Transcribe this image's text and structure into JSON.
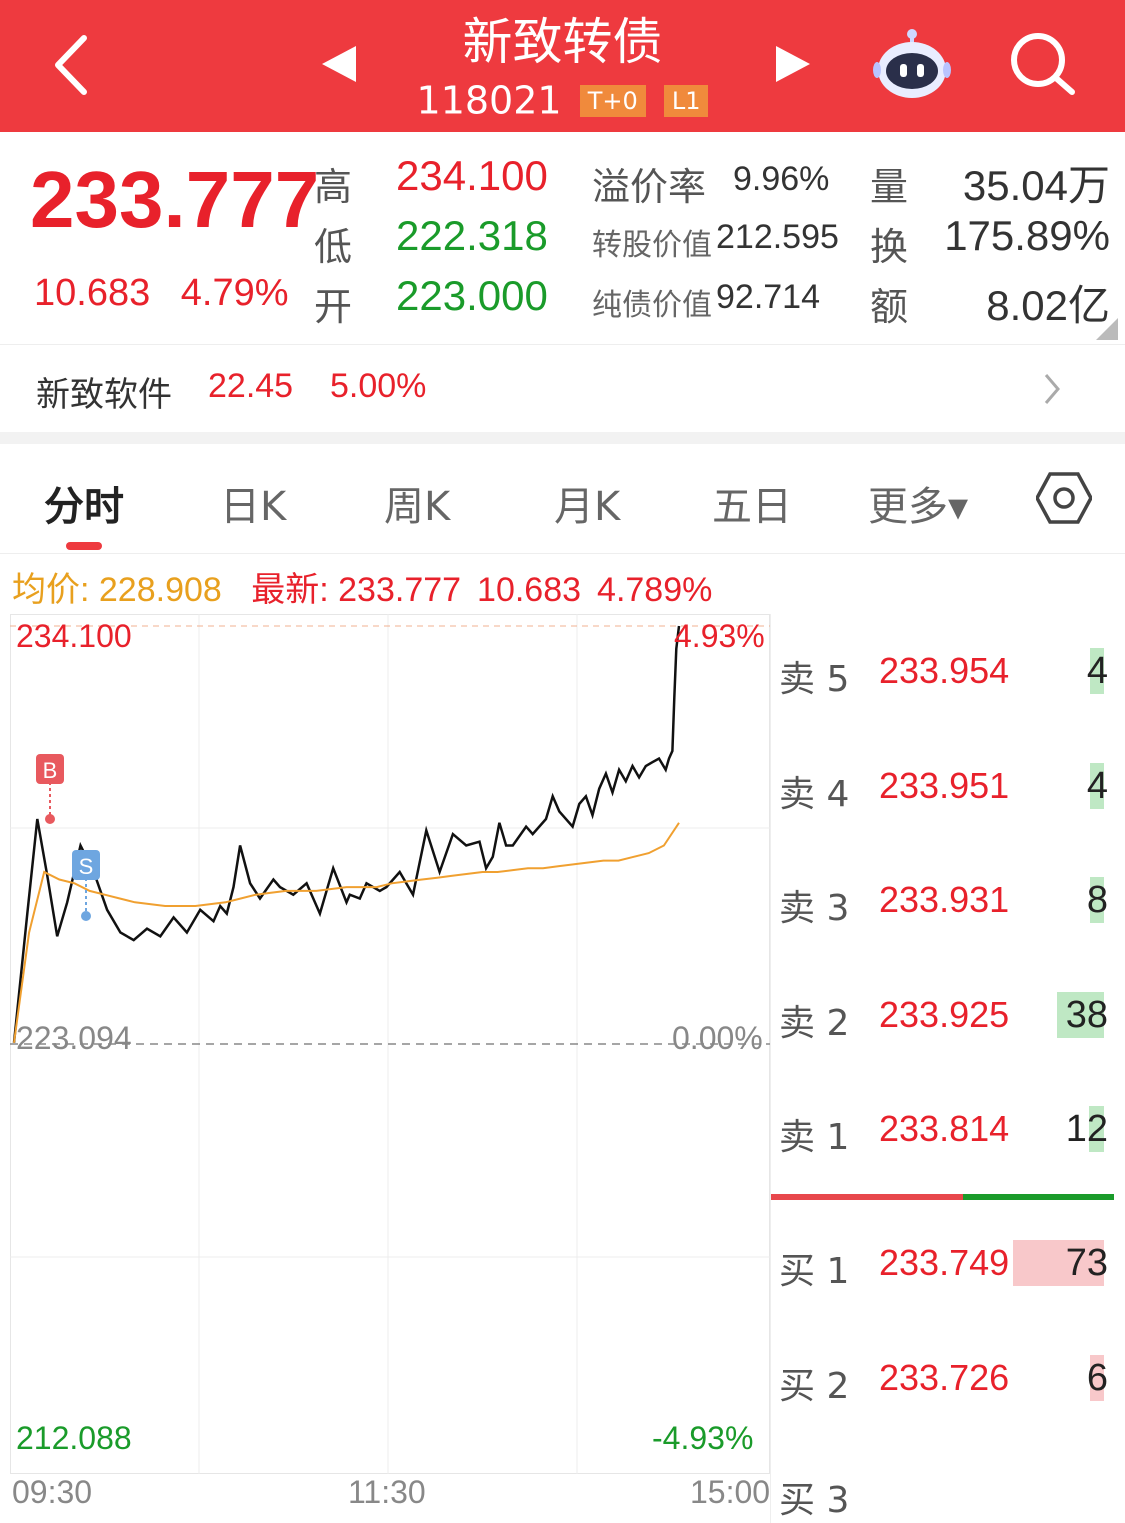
{
  "header": {
    "title": "新致转债",
    "code": "118021",
    "tags": [
      "T+0",
      "L1"
    ]
  },
  "quote": {
    "last_price": "233.777",
    "change": "10.683",
    "change_pct": "4.79%",
    "high_label": "高",
    "high": "234.100",
    "low_label": "低",
    "low": "222.318",
    "open_label": "开",
    "open": "223.000",
    "premium_label": "溢价率",
    "premium": "9.96%",
    "conv_value_label": "转股价值",
    "conv_value": "212.595",
    "bond_value_label": "纯债价值",
    "bond_value": "92.714",
    "volume_label": "量",
    "volume": "35.04万",
    "turnover_label": "换",
    "turnover": "175.89%",
    "amount_label": "额",
    "amount": "8.02亿"
  },
  "stock": {
    "name": "新致软件",
    "price": "22.45",
    "change_pct": "5.00%"
  },
  "tabs": [
    "分时",
    "日K",
    "周K",
    "月K",
    "五日",
    "更多▾"
  ],
  "chart_info": {
    "avg_label": "均价: 228.908",
    "latest_label": "最新: 233.777",
    "latest_change": "10.683",
    "latest_pct": "4.789%"
  },
  "chart_data": {
    "type": "line",
    "y_axis": {
      "max": "234.100",
      "mid": "223.094",
      "min": "212.088"
    },
    "pct_axis": {
      "max": "4.93%",
      "mid": "0.00%",
      "min": "-4.93%"
    },
    "x_ticks": [
      "09:30",
      "11:30",
      "15:00"
    ],
    "ylim": [
      212.088,
      234.1
    ],
    "markers": [
      {
        "label": "B",
        "color": "#e8595e"
      },
      {
        "label": "S",
        "color": "#6ea6e0"
      }
    ],
    "series": [
      {
        "color": "#111111",
        "values": [
          223.09,
          226.5,
          229.0,
          227.5,
          225.9,
          226.8,
          228.3,
          227.6,
          226.6,
          226.0,
          225.8,
          226.1,
          225.9,
          226.4,
          226.0,
          226.6,
          226.3,
          226.7,
          226.5,
          227.2,
          228.3,
          227.3,
          226.9,
          227.4,
          227.2,
          227.0,
          227.3,
          226.5,
          227.7,
          226.8,
          227.0,
          226.9,
          227.3,
          227.1,
          227.2,
          227.6,
          227.0,
          228.7,
          227.6,
          228.6,
          228.3,
          228.4,
          227.7,
          228.0,
          228.9,
          228.3,
          228.3,
          228.8,
          228.6,
          229.0,
          229.6,
          229.2,
          228.8,
          229.4,
          229.6,
          229.1,
          229.8,
          230.2,
          229.7,
          230.3,
          230.0,
          230.4,
          230.1,
          230.4,
          230.5,
          230.6,
          230.3,
          230.6,
          230.8,
          232.2,
          233.5,
          234.1
        ]
      },
      {
        "color": "#f0a030",
        "values": [
          223.09,
          226.0,
          227.6,
          227.4,
          227.3,
          227.1,
          227.0,
          226.9,
          226.8,
          226.75,
          226.7,
          226.7,
          226.7,
          226.75,
          226.8,
          226.9,
          227.0,
          227.05,
          227.1,
          227.1,
          227.1,
          227.15,
          227.2,
          227.2,
          227.2,
          227.3,
          227.35,
          227.4,
          227.45,
          227.5,
          227.55,
          227.6,
          227.6,
          227.65,
          227.7,
          227.7,
          227.75,
          227.8,
          227.85,
          227.9,
          227.9,
          228.0,
          228.1,
          228.3,
          228.9
        ]
      }
    ]
  },
  "order_book": {
    "asks": [
      {
        "label": "卖 5",
        "price": "233.954",
        "vol": "4",
        "vol_num": 4
      },
      {
        "label": "卖 4",
        "price": "233.951",
        "vol": "4",
        "vol_num": 4
      },
      {
        "label": "卖 3",
        "price": "233.931",
        "vol": "8",
        "vol_num": 8
      },
      {
        "label": "卖 2",
        "price": "233.925",
        "vol": "38",
        "vol_num": 38
      },
      {
        "label": "卖 1",
        "price": "233.814",
        "vol": "12",
        "vol_num": 12
      }
    ],
    "bids": [
      {
        "label": "买 1",
        "price": "233.749",
        "vol": "73",
        "vol_num": 73
      },
      {
        "label": "买 2",
        "price": "233.726",
        "vol": "6",
        "vol_num": 6
      },
      {
        "label": "买 3",
        "price": "",
        "vol": "",
        "vol_num": 0
      }
    ],
    "ask_share": 0.56
  }
}
